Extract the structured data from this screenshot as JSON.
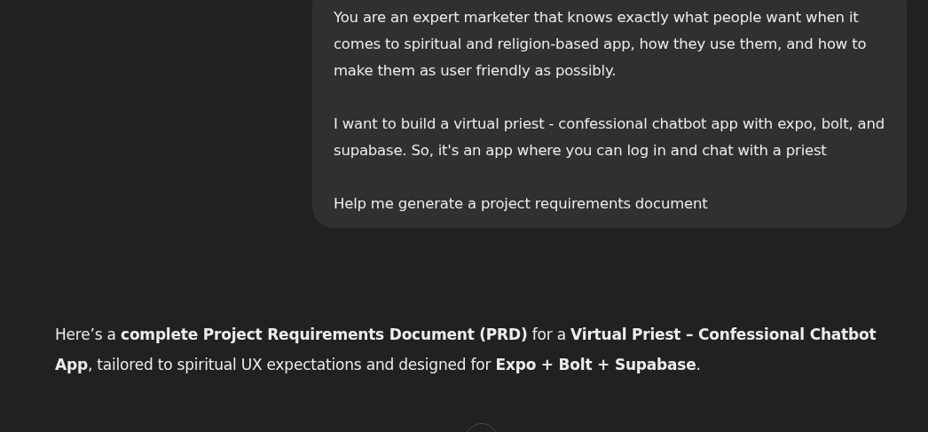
{
  "user_message": {
    "paragraphs": [
      "You are an expert marketer that knows exactly what people want when it comes to spiritual and religion-based app, how they use them, and how to make them as user friendly as possibly.",
      "I want to build a virtual priest - confessional chatbot app with expo, bolt, and supabase. So, it's an app where you can log in and chat with a priest",
      "Help me generate a project requirements document"
    ]
  },
  "assistant_message": {
    "text": "Here’s a **complete Project Requirements Document (PRD)** for a **Virtual Priest – Confessional Chatbot App**, tailored to spiritual UX expectations and designed for **Expo + Bolt + Supabase**."
  }
}
